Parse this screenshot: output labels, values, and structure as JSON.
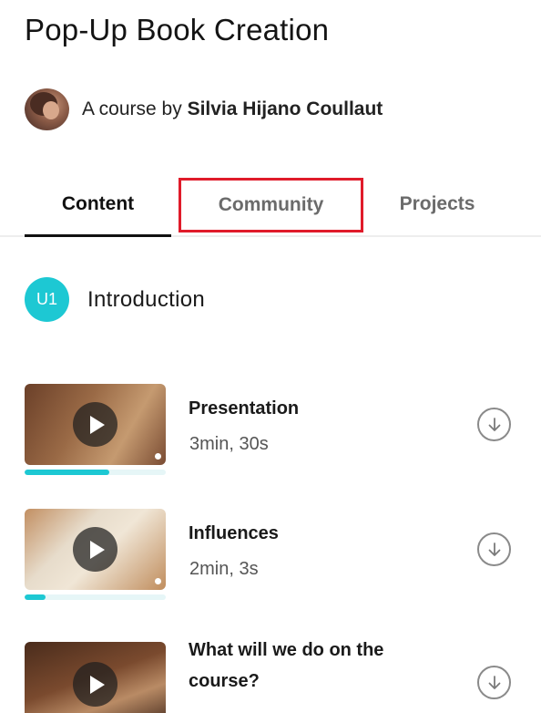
{
  "course": {
    "title": "Pop-Up Book Creation",
    "byline_prefix": "A course by",
    "author": "Silvia Hijano Coullaut"
  },
  "tabs": [
    {
      "label": "Content",
      "active": true
    },
    {
      "label": "Community",
      "highlighted": true
    },
    {
      "label": "Projects"
    }
  ],
  "unit": {
    "badge": "U1",
    "title": "Introduction"
  },
  "lessons": [
    {
      "title": "Presentation",
      "duration": "3min, 30s",
      "progress": 0.6
    },
    {
      "title": "Influences",
      "duration": "2min, 3s",
      "progress": 0.15
    },
    {
      "title_line1": "What will we do on the",
      "title_line2": "course?",
      "duration": ""
    }
  ],
  "colors": {
    "accent": "#1dc8d3",
    "highlight_box": "#e01b2a"
  },
  "icons": {
    "download": "download-icon",
    "play": "play-icon"
  }
}
